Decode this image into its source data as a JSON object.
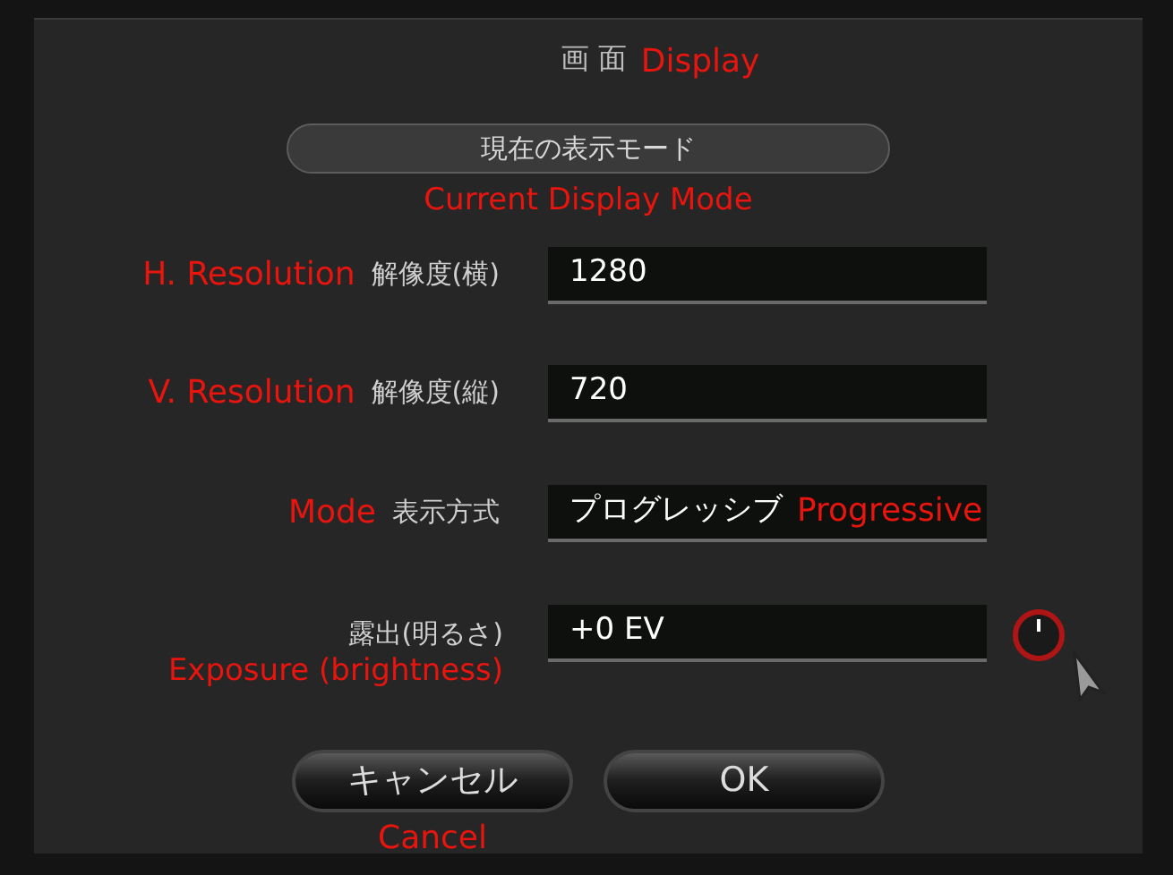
{
  "dialog": {
    "title": "画 面",
    "title_annotation": "Display"
  },
  "mode_button": {
    "label": "現在の表示モード",
    "annotation": "Current Display Mode"
  },
  "fields": [
    {
      "kind": "text",
      "annotation": "H. Resolution",
      "label": "解像度(横)",
      "value": "1280"
    },
    {
      "kind": "text",
      "annotation": "V. Resolution",
      "label": "解像度(縦)",
      "value": "720"
    },
    {
      "kind": "text",
      "annotation": "Mode",
      "label": "表示方式",
      "value": "プログレッシブ",
      "value_annotation": "Progressive"
    }
  ],
  "exposure": {
    "label": "露出(明るさ)",
    "annotation": "Exposure (brightness)",
    "value": "+0 EV"
  },
  "buttons": [
    {
      "label": "キャンセル",
      "annotation": "Cancel"
    },
    {
      "label": "OK"
    }
  ]
}
